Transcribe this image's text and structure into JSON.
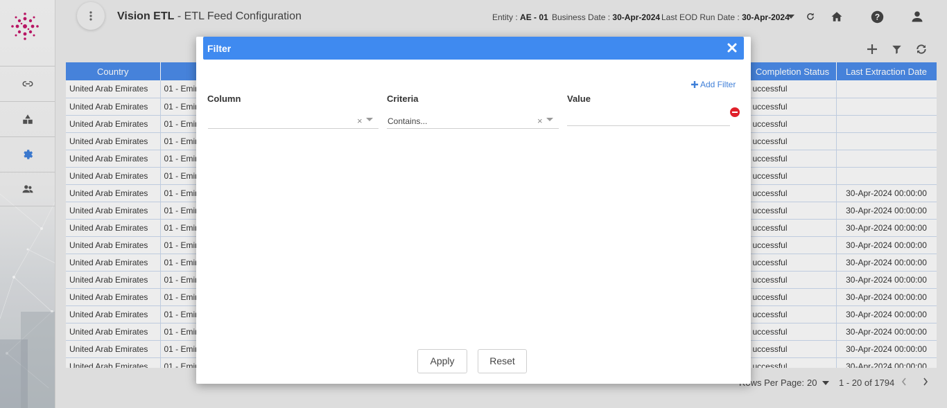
{
  "header": {
    "app_name": "Vision ETL",
    "page_subtitle": "- ETL Feed Configuration",
    "entity_label": "Entity :",
    "entity_value": "AE - 01",
    "business_date_label": "Business Date :",
    "business_date_value": "30-Apr-2024",
    "eod_label": "Last EOD Run Date :",
    "eod_value": "30-Apr-2024"
  },
  "sidebar": {
    "items": [
      {
        "icon": "link-icon"
      },
      {
        "icon": "shapes-icon"
      },
      {
        "icon": "gear-icon"
      },
      {
        "icon": "users-icon"
      }
    ]
  },
  "table": {
    "columns": [
      "Country",
      "Completion Status",
      "Last Extraction Date"
    ],
    "country_value": "United Arab Emirates",
    "le_partial": "01 - Emir",
    "status_partial": "uccessful",
    "rows": [
      {
        "date": ""
      },
      {
        "date": ""
      },
      {
        "date": ""
      },
      {
        "date": ""
      },
      {
        "date": ""
      },
      {
        "date": ""
      },
      {
        "date": "30-Apr-2024 00:00:00"
      },
      {
        "date": "30-Apr-2024 00:00:00"
      },
      {
        "date": "30-Apr-2024 00:00:00"
      },
      {
        "date": "30-Apr-2024 00:00:00"
      },
      {
        "date": "30-Apr-2024 00:00:00"
      },
      {
        "date": "30-Apr-2024 00:00:00"
      },
      {
        "date": "30-Apr-2024 00:00:00"
      },
      {
        "date": "30-Apr-2024 00:00:00"
      },
      {
        "date": "30-Apr-2024 00:00:00"
      },
      {
        "date": "30-Apr-2024 00:00:00"
      },
      {
        "date": "30-Apr-2024 00:00:00"
      }
    ]
  },
  "pagination": {
    "rows_per_page_label": "Rows Per Page:",
    "rows_per_page_value": "20",
    "range": "1 - 20 of 1794"
  },
  "modal": {
    "title": "Filter",
    "add_filter": "Add Filter",
    "column_label": "Column",
    "criteria_label": "Criteria",
    "value_label": "Value",
    "column_value": "",
    "criteria_value": "Contains...",
    "value_value": "",
    "apply": "Apply",
    "reset": "Reset"
  },
  "colors": {
    "accent": "#3f8af0",
    "table_header": "#4a8ae6",
    "remove": "#e0202a",
    "logo": "#c2186a"
  }
}
